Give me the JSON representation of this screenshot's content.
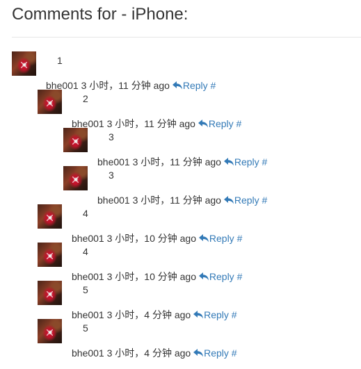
{
  "page": {
    "title": "Comments for - iPhone:"
  },
  "reply_color": "#337ab7",
  "comments": [
    {
      "text": "1",
      "author": "bhe001",
      "time": "3 小时，11 分钟 ago",
      "reply_label": "Reply",
      "permalink": "#"
    },
    {
      "text": "2",
      "author": "bhe001",
      "time": "3 小时，11 分钟 ago",
      "reply_label": "Reply",
      "permalink": "#"
    },
    {
      "text": "3",
      "author": "bhe001",
      "time": "3 小时，11 分钟 ago",
      "reply_label": "Reply",
      "permalink": "#"
    },
    {
      "text": "3",
      "author": "bhe001",
      "time": "3 小时，11 分钟 ago",
      "reply_label": "Reply",
      "permalink": "#"
    },
    {
      "text": "4",
      "author": "bhe001",
      "time": "3 小时，10 分钟 ago",
      "reply_label": "Reply",
      "permalink": "#"
    },
    {
      "text": "4",
      "author": "bhe001",
      "time": "3 小时，10 分钟 ago",
      "reply_label": "Reply",
      "permalink": "#"
    },
    {
      "text": "5",
      "author": "bhe001",
      "time": "3 小时，4 分钟 ago",
      "reply_label": "Reply",
      "permalink": "#"
    },
    {
      "text": "5",
      "author": "bhe001",
      "time": "3 小时，4 分钟 ago",
      "reply_label": "Reply",
      "permalink": "#"
    }
  ]
}
